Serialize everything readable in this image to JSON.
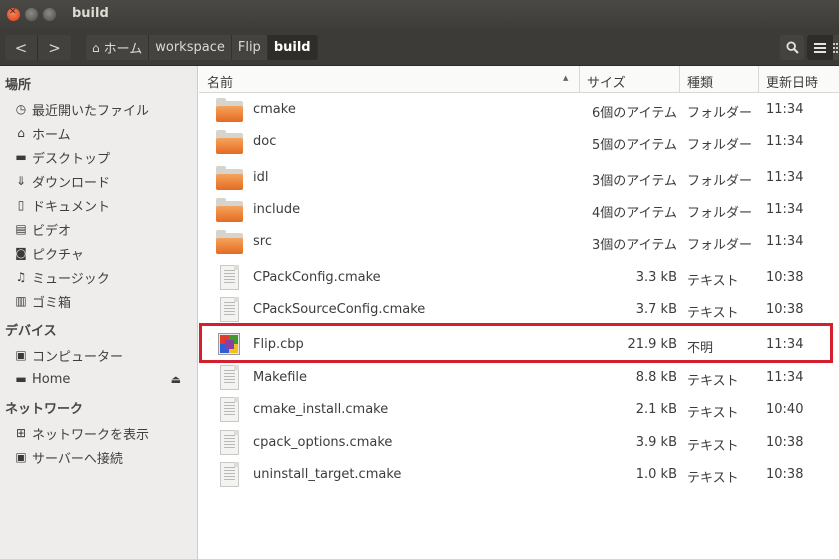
{
  "window": {
    "title": "build"
  },
  "toolbar": {
    "back_label": "<",
    "forward_label": ">",
    "breadcrumbs": [
      "ホーム",
      "workspace",
      "Flip",
      "build"
    ],
    "home_glyph": "⌂"
  },
  "sidebar": {
    "places_header": "場所",
    "places": [
      {
        "label": "最近開いたファイル",
        "icon": "clock-icon"
      },
      {
        "label": "ホーム",
        "icon": "home-icon"
      },
      {
        "label": "デスクトップ",
        "icon": "desktop-icon"
      },
      {
        "label": "ダウンロード",
        "icon": "download-icon"
      },
      {
        "label": "ドキュメント",
        "icon": "document-icon"
      },
      {
        "label": "ビデオ",
        "icon": "video-icon"
      },
      {
        "label": "ピクチャ",
        "icon": "camera-icon"
      },
      {
        "label": "ミュージック",
        "icon": "music-icon"
      },
      {
        "label": "ゴミ箱",
        "icon": "trash-icon"
      }
    ],
    "devices_header": "デバイス",
    "devices": [
      {
        "label": "コンピューター",
        "icon": "computer-icon"
      },
      {
        "label": "Home",
        "icon": "drive-icon"
      }
    ],
    "network_header": "ネットワーク",
    "network": [
      {
        "label": "ネットワークを表示",
        "icon": "network-icon"
      },
      {
        "label": "サーバーへ接続",
        "icon": "server-icon"
      }
    ]
  },
  "columns": {
    "name": "名前",
    "size": "サイズ",
    "kind": "種類",
    "modified": "更新日時"
  },
  "files": [
    {
      "name": "cmake",
      "size": "6個のアイテム",
      "kind": "フォルダー",
      "time": "11:34",
      "icon": "folder-icon"
    },
    {
      "name": "doc",
      "size": "5個のアイテム",
      "kind": "フォルダー",
      "time": "11:34",
      "icon": "folder-icon"
    },
    {
      "name": "idl",
      "size": "3個のアイテム",
      "kind": "フォルダー",
      "time": "11:34",
      "icon": "folder-icon"
    },
    {
      "name": "include",
      "size": "4個のアイテム",
      "kind": "フォルダー",
      "time": "11:34",
      "icon": "folder-icon"
    },
    {
      "name": "src",
      "size": "3個のアイテム",
      "kind": "フォルダー",
      "time": "11:34",
      "icon": "folder-icon"
    },
    {
      "name": "CPackConfig.cmake",
      "size": "3.3 kB",
      "kind": "テキスト",
      "time": "10:38",
      "icon": "text-file-icon"
    },
    {
      "name": "CPackSourceConfig.cmake",
      "size": "3.7 kB",
      "kind": "テキスト",
      "time": "10:38",
      "icon": "text-file-icon"
    },
    {
      "name": "Flip.cbp",
      "size": "21.9 kB",
      "kind": "不明",
      "time": "11:34",
      "icon": "unknown-app-file-icon"
    },
    {
      "name": "Makefile",
      "size": "8.8 kB",
      "kind": "テキスト",
      "time": "11:34",
      "icon": "text-file-icon"
    },
    {
      "name": "cmake_install.cmake",
      "size": "2.1 kB",
      "kind": "テキスト",
      "time": "10:40",
      "icon": "text-file-icon"
    },
    {
      "name": "cpack_options.cmake",
      "size": "3.9 kB",
      "kind": "テキスト",
      "time": "10:38",
      "icon": "text-file-icon"
    },
    {
      "name": "uninstall_target.cmake",
      "size": "1.0 kB",
      "kind": "テキスト",
      "time": "10:38",
      "icon": "text-file-icon"
    }
  ],
  "colors": {
    "highlight": "#d41f2f",
    "folder": "#e8782f",
    "toolbar": "#3c3b37"
  }
}
